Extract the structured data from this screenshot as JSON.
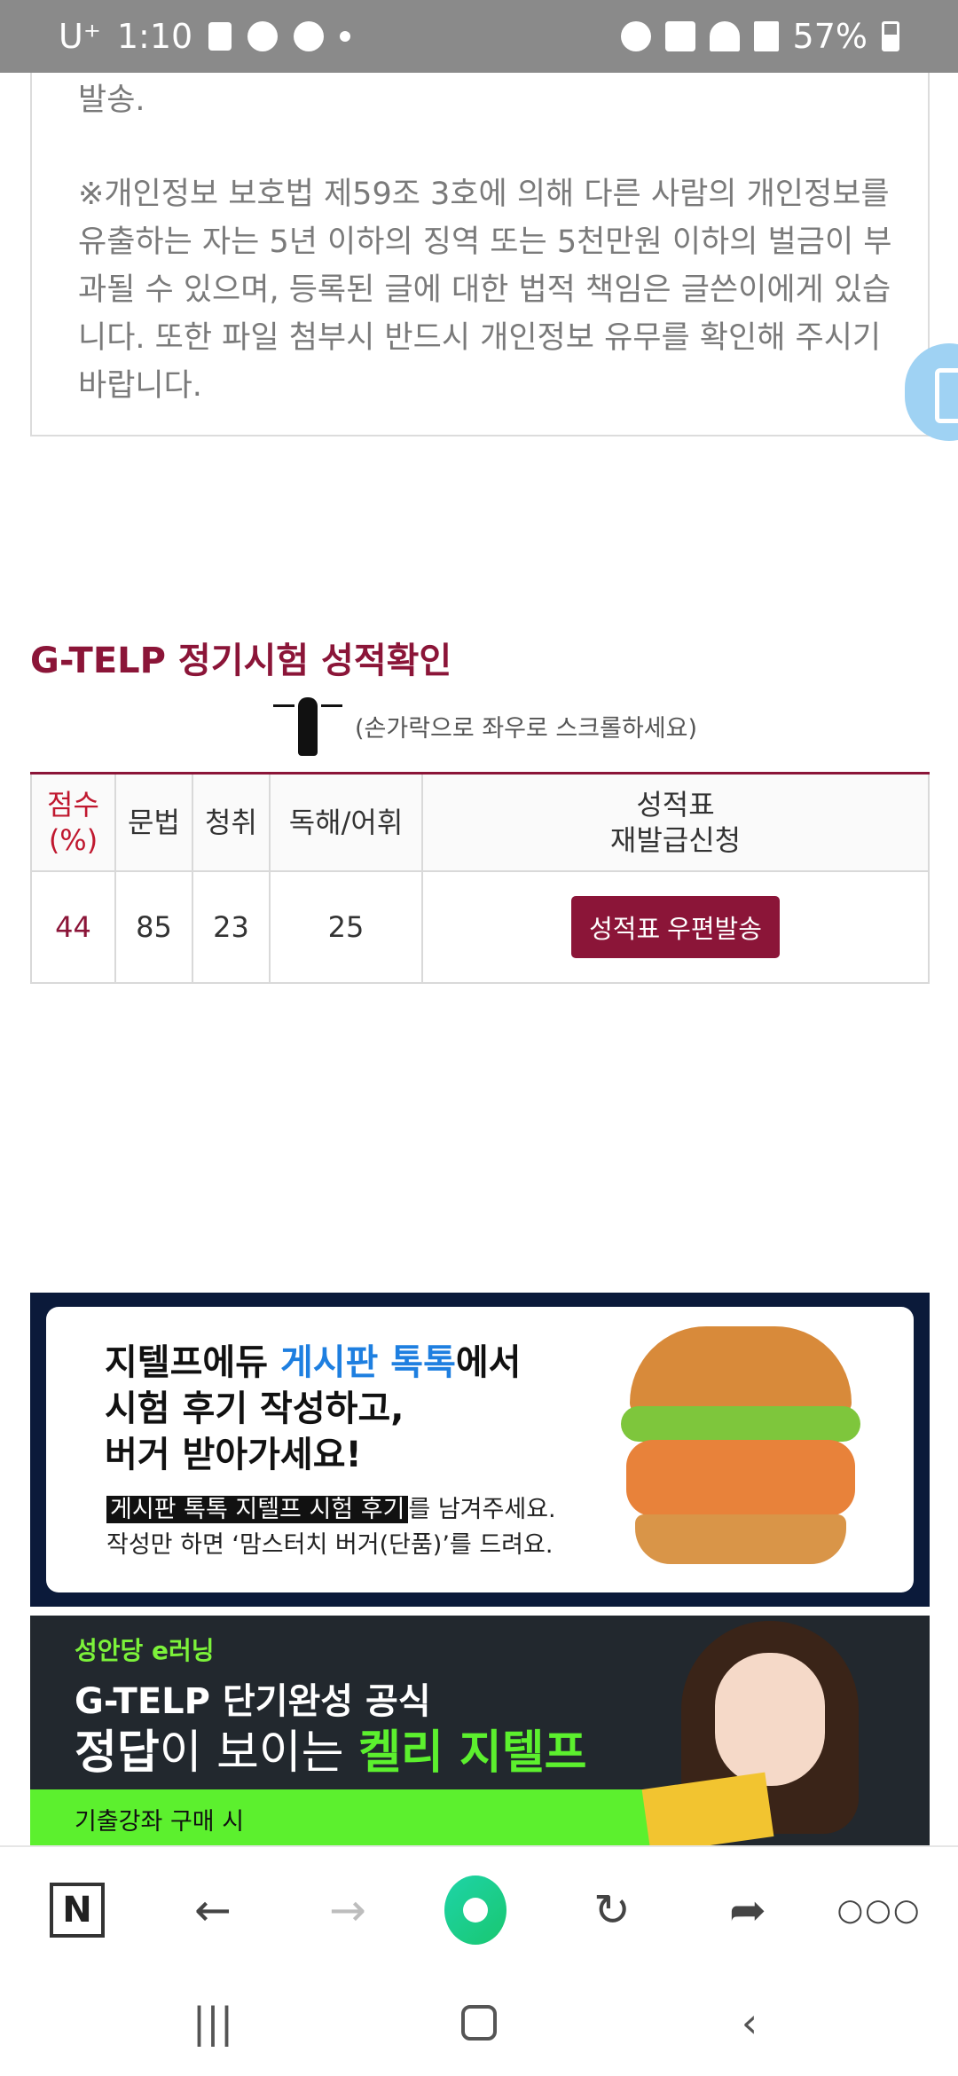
{
  "status_bar": {
    "carrier": "U⁺",
    "time": "1:10",
    "battery": "57%"
  },
  "notice": {
    "top_line": "발송.",
    "main_text": "※개인정보 보호법 제59조 3호에 의해 다른 사람의 개인정보를 유출하는 자는 5년 이하의 징역 또는 5천만원 이하의 벌금이 부과될 수 있으며, 등록된 글에 대한 법적 책임은 글쓴이에게 있습니다. 또한 파일 첨부시 반드시 개인정보 유무를 확인해 주시기 바랍니다."
  },
  "score_section": {
    "title": "G-TELP 정기시험 성적확인",
    "scroll_hint": "(손가락으로 좌우로 스크롤하세요)",
    "headers": {
      "score": "점수(%)",
      "grammar": "문법",
      "listening": "청취",
      "reading": "독해/어휘",
      "reissue_line1": "성적표",
      "reissue_line2": "재발급신청"
    },
    "row": {
      "score": "44",
      "grammar": "85",
      "listening": "23",
      "reading": "25",
      "reissue_button": "성적표 우편발송"
    }
  },
  "banner1": {
    "line1_a": "지텔프에듀 ",
    "line1_b": "게시판 톡톡",
    "line1_c": "에서",
    "line2": "시험 후기 작성하고,",
    "line3": "버거 받아가세요!",
    "sub1_hl": "게시판 톡톡 지텔프 시험 후기",
    "sub1_rest": "를 남겨주세요.",
    "sub2": "작성만 하면 ‘맘스터치 버거(단품)’를 드려요."
  },
  "banner2": {
    "brand": "성안당 e러닝",
    "line1": "G-TELP 단기완성 공식",
    "line2_a": "정답",
    "line2_b": "이 보이는 ",
    "line2_c": "켈리 지텔프",
    "strip": "기출강좌 구매 시"
  },
  "browser_bar": {
    "n_label": "N"
  },
  "colors": {
    "accent": "#8b1538",
    "status_bar": "#8a8a8a",
    "banner_blue": "#1e7fe0",
    "banner_green": "#5cf02e"
  }
}
